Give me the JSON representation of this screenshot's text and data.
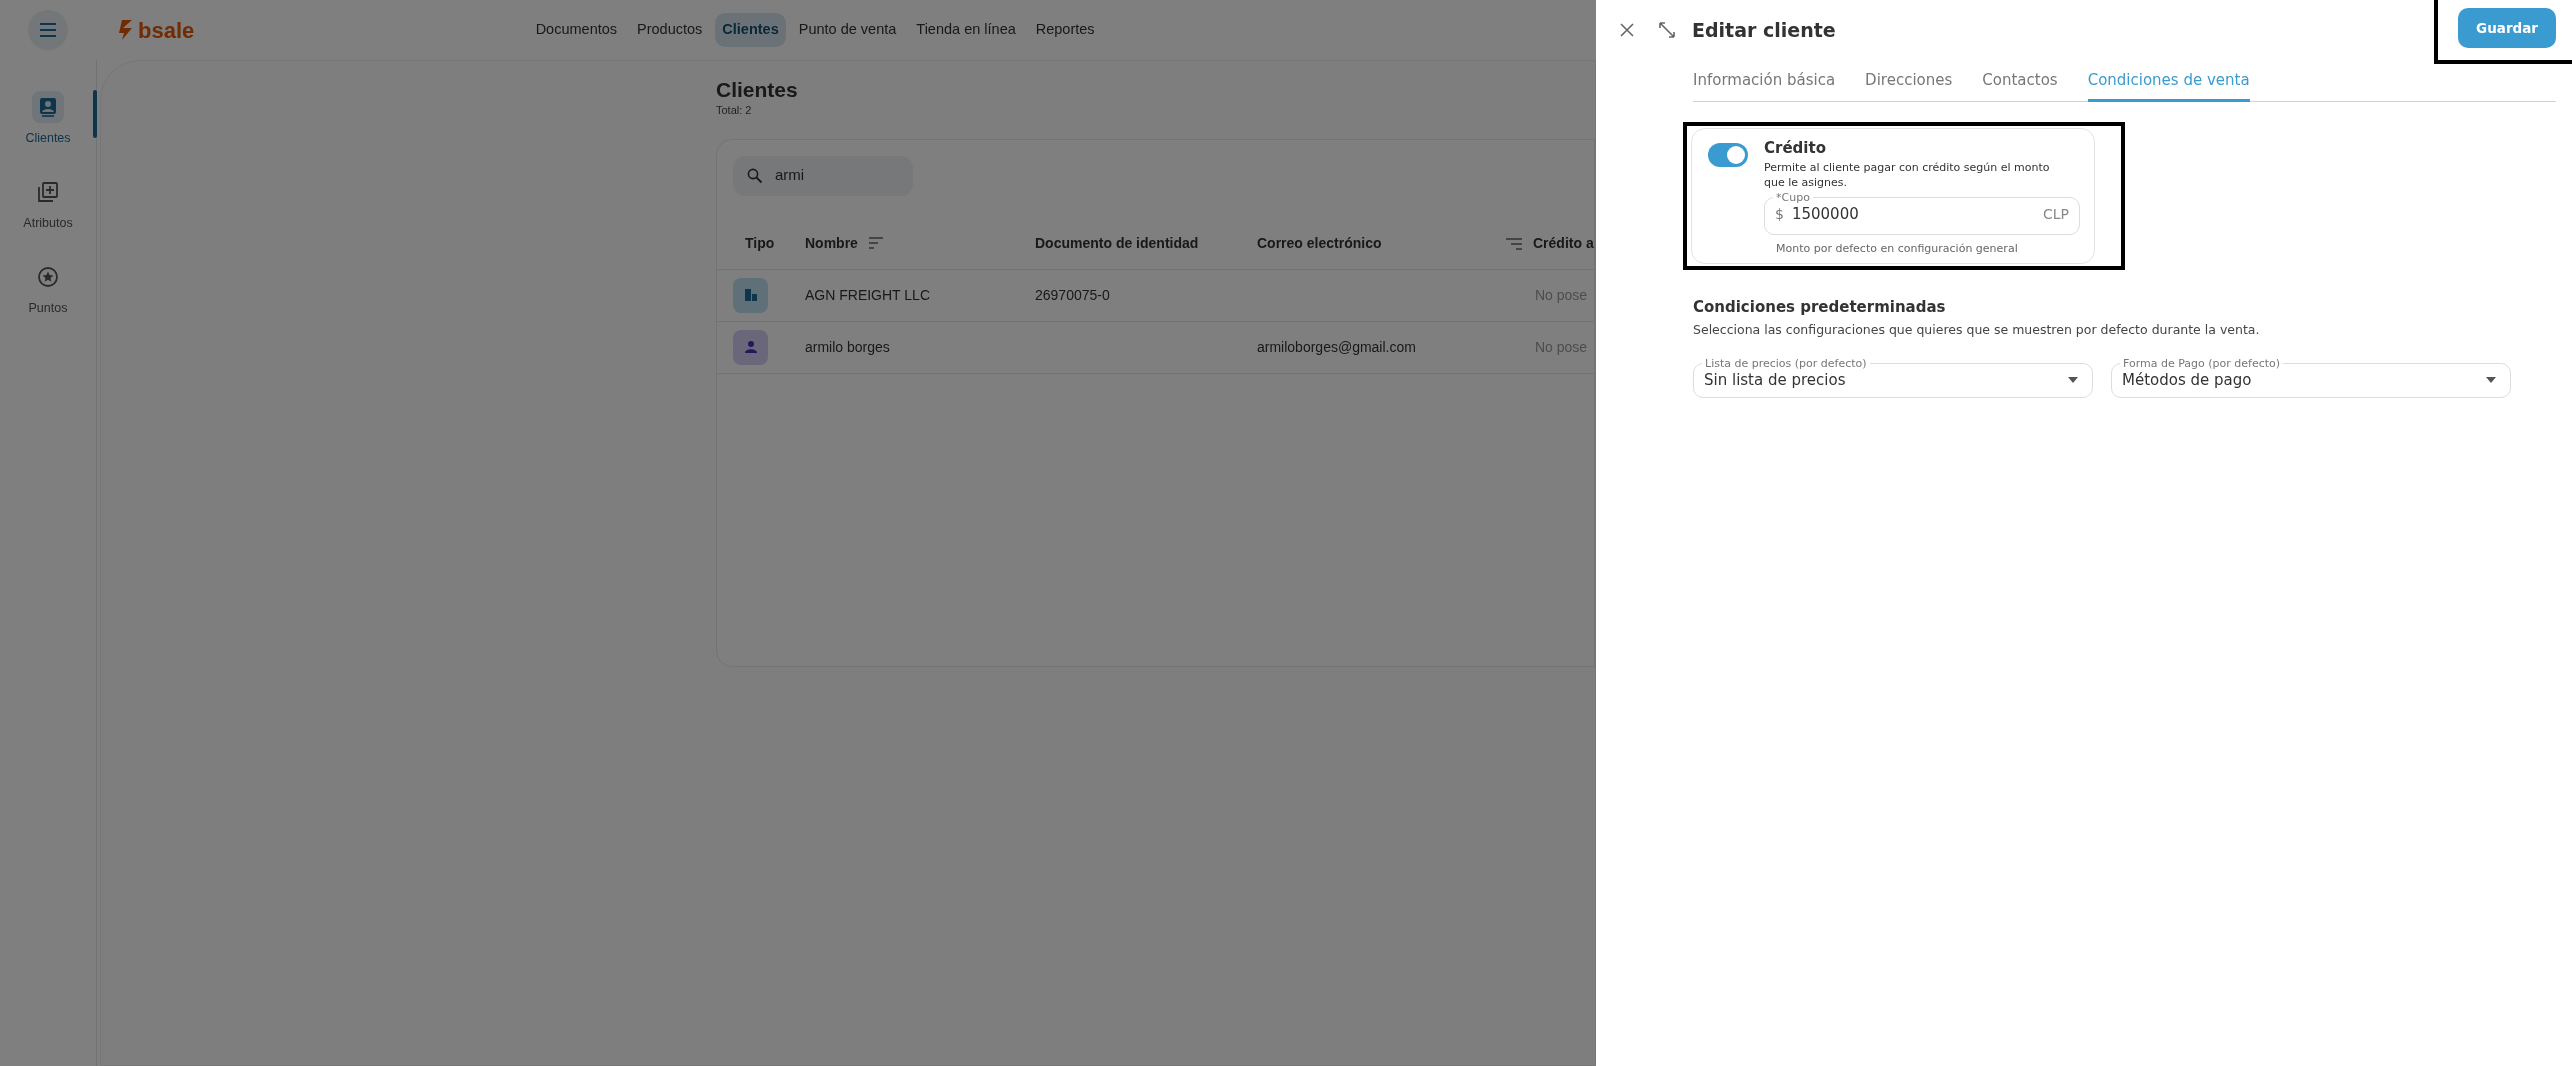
{
  "app": {
    "logo": "bsale"
  },
  "sidebar": {
    "items": [
      {
        "kind": "clients",
        "label": "Clientes",
        "selected": true
      },
      {
        "kind": "attributes",
        "label": "Atributos",
        "selected": false
      },
      {
        "kind": "points",
        "label": "Puntos",
        "selected": false
      }
    ]
  },
  "nav": [
    {
      "label": "Documentos",
      "selected": false
    },
    {
      "label": "Productos",
      "selected": false
    },
    {
      "label": "Clientes",
      "selected": true
    },
    {
      "label": "Punto de venta",
      "selected": false
    },
    {
      "label": "Tienda en línea",
      "selected": false
    },
    {
      "label": "Reportes",
      "selected": false
    }
  ],
  "page": {
    "title": "Clientes",
    "total": "Total: 2"
  },
  "search": {
    "value": "armi"
  },
  "table": {
    "columns": [
      "Tipo",
      "Nombre",
      "Documento de identidad",
      "Correo electrónico",
      "Crédito a"
    ],
    "rows": [
      {
        "kind": "company",
        "name": "AGN FREIGHT LLC",
        "document": "26970075-0",
        "credit": "No pose"
      },
      {
        "kind": "person",
        "name": "armilo borges",
        "email": "armiloborges@gmail.com",
        "credit": "No pose"
      }
    ]
  },
  "panel": {
    "title": "Editar cliente",
    "save": {
      "label": "Guardar",
      "highlighted": true
    },
    "tabs": [
      {
        "label": "Información básica",
        "selected": false
      },
      {
        "label": "Direcciones",
        "selected": false
      },
      {
        "label": "Contactos",
        "selected": false
      },
      {
        "label": "Condiciones de venta",
        "selected": true
      }
    ],
    "credit": {
      "highlighted": true,
      "on": true,
      "title": "Crédito",
      "description": "Permite al cliente pagar con crédito según el monto que le asignes.",
      "field": {
        "label": "*Cupo",
        "prefix": "$",
        "value": "1500000",
        "suffix": "CLP"
      },
      "helper": "Monto por defecto en configuración general"
    },
    "defaults": {
      "title": "Condiciones predeterminadas",
      "description": "Selecciona las configuraciones que quieres que se muestren por defecto durante la venta.",
      "selects": [
        {
          "label": "Lista de precios (por defecto)",
          "value": "Sin lista de precios"
        },
        {
          "label": "Forma de Pago (por defecto)",
          "value": "Métodos de pago"
        }
      ]
    }
  }
}
